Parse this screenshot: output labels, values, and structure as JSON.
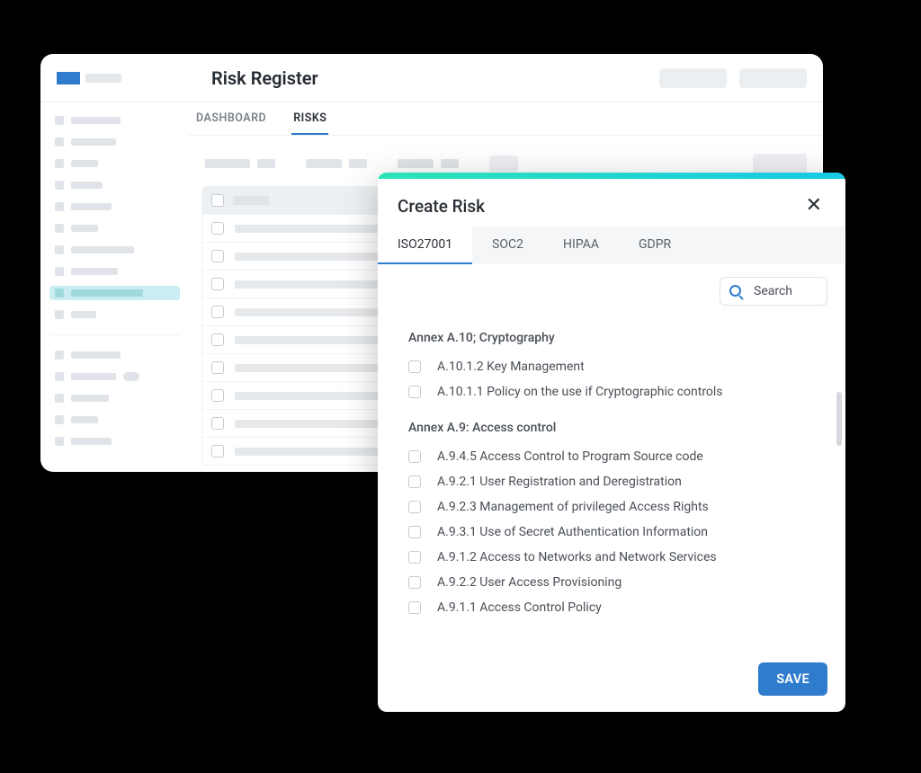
{
  "main": {
    "title": "Risk Register",
    "tabs": [
      "DASHBOARD",
      "RISKS"
    ],
    "active_tab_index": 1
  },
  "modal": {
    "title": "Create Risk",
    "tabs": [
      "ISO27001",
      "SOC2",
      "HIPAA",
      "GDPR"
    ],
    "active_tab_index": 0,
    "search_label": "Search",
    "save_label": "SAVE",
    "groups": [
      {
        "title": "Annex A.10; Cryptography",
        "items": [
          "A.10.1.2 Key Management",
          "A.10.1.1 Policy on the use if Cryptographic controls"
        ]
      },
      {
        "title": "Annex A.9: Access control",
        "items": [
          "A.9.4.5 Access Control to Program Source code",
          "A.9.2.1 User Registration and Deregistration",
          "A.9.2.3 Management of privileged Access Rights",
          "A.9.3.1 Use of Secret Authentication Information",
          "A.9.1.2 Access to Networks and Network Services",
          "A.9.2.2 User Access Provisioning",
          "A.9.1.1 Access Control Policy"
        ]
      }
    ]
  }
}
